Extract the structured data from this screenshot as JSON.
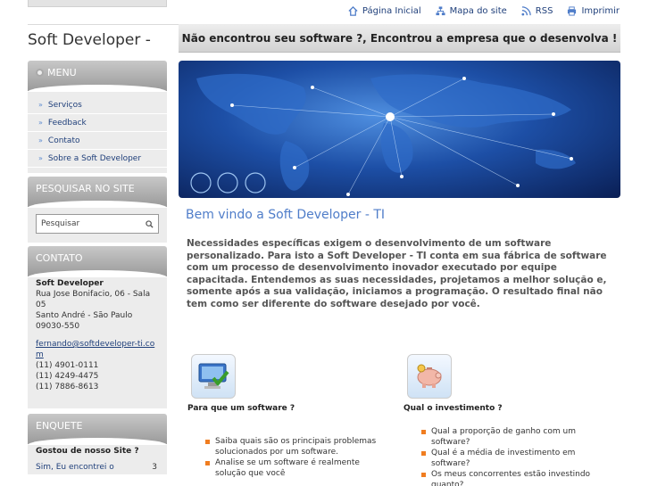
{
  "top_links": [
    {
      "label": "Página Inicial",
      "icon": "home-icon"
    },
    {
      "label": "Mapa do site",
      "icon": "sitemap-icon"
    },
    {
      "label": "RSS",
      "icon": "rss-icon"
    },
    {
      "label": "Imprimir",
      "icon": "print-icon"
    }
  ],
  "site_title": "Soft Developer -",
  "tagline": "Não encontrou seu software ?, Encontrou a empresa que o desenvolva !",
  "menu": {
    "title": "MENU",
    "items": [
      "Serviços",
      "Feedback",
      "Contato",
      "Sobre a Soft Developer"
    ]
  },
  "search": {
    "title": "PESQUISAR NO SITE",
    "placeholder": "Pesquisar"
  },
  "contact": {
    "title": "CONTATO",
    "name": "Soft Developer",
    "address": "Rua Jose Bonifacio, 06 - Sala 05",
    "city": "Santo André - São Paulo",
    "zip": "09030-550",
    "email": "fernando@softdeveloper-ti.com",
    "phones": [
      "(11) 4901-0111",
      "(11) 4249-4475",
      "(11) 7886-8613"
    ]
  },
  "poll": {
    "title": "ENQUETE",
    "question": "Gostou de nosso Site ?",
    "option": "Sim, Eu encontrei o",
    "count": "3"
  },
  "welcome": "Bem vindo a Soft Developer - TI",
  "intro": "Necessidades específicas exigem o desenvolvimento de um software personalizado. Para isto a Soft Developer - TI conta em sua fábrica de software com um processo de desenvolvimento inovador executado por equipe capacitada. Entendemos as suas necessidades, projetamos a melhor solução e, somente após a sua validação, iniciamos a programação. O resultado final não tem como ser diferente do software desejado por você.",
  "features": [
    {
      "title": "Para que um software ?",
      "icon": "computer-check-icon",
      "items": [
        "Saiba quais são os principais problemas solucionados por um software.",
        "Analise se um software é realmente solução que você"
      ]
    },
    {
      "title": "Qual o investimento ?",
      "icon": "piggy-bank-icon",
      "items": [
        "Qual a proporção de ganho com um software?",
        "Qual é a média de investimento em software?",
        "Os meus concorrentes estão investindo quanto?"
      ]
    }
  ],
  "colors": {
    "link": "#1f3f7a",
    "accent": "#4f7dc9",
    "bullet": "#f07d20"
  }
}
